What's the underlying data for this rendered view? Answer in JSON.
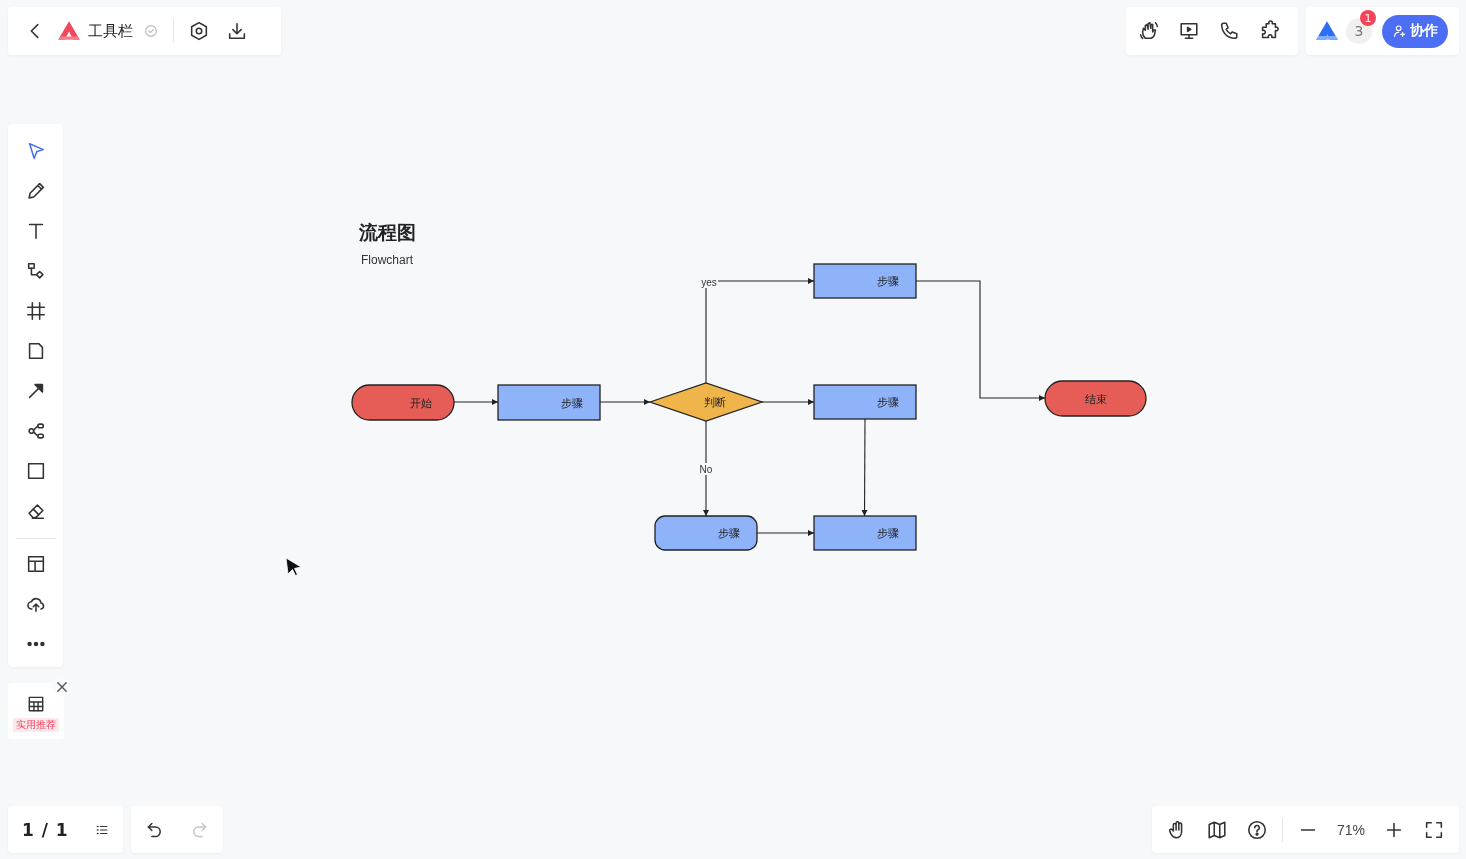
{
  "header": {
    "title": "工具栏",
    "saved": true,
    "actions": [
      {
        "kind": "settings"
      },
      {
        "kind": "download"
      }
    ]
  },
  "top_tools": [
    {
      "kind": "wave"
    },
    {
      "kind": "present"
    },
    {
      "kind": "call"
    },
    {
      "kind": "plugin"
    }
  ],
  "collaboration": {
    "member_count": "3",
    "notification_count": "1",
    "button": "协作"
  },
  "toolbar": {
    "tools": [
      {
        "kind": "select",
        "selected": true
      },
      {
        "kind": "pen",
        "selected": false
      },
      {
        "kind": "text",
        "selected": false
      },
      {
        "kind": "flow",
        "selected": false
      },
      {
        "kind": "frame",
        "selected": false
      },
      {
        "kind": "note",
        "selected": false
      },
      {
        "kind": "arrow",
        "selected": false
      },
      {
        "kind": "mindmap",
        "selected": false
      },
      {
        "kind": "shape",
        "selected": false
      },
      {
        "kind": "eraser",
        "selected": false
      }
    ],
    "extras": [
      {
        "kind": "template"
      },
      {
        "kind": "upload"
      },
      {
        "kind": "more"
      }
    ]
  },
  "recommend": {
    "label": "实用推荐"
  },
  "diagram": {
    "title": "流程图",
    "subtitle": "Flowchart",
    "nodes": [
      {
        "kind": "terminal",
        "label": "开始",
        "color": "#e65c57"
      },
      {
        "kind": "process",
        "label": "步骤",
        "color": "#8eb3f9"
      },
      {
        "kind": "decision",
        "label": "判断",
        "color": "#efb44a"
      },
      {
        "kind": "process",
        "label": "步骤",
        "color": "#8eb3f9"
      },
      {
        "kind": "process",
        "label": "步骤",
        "color": "#8eb3f9"
      },
      {
        "kind": "terminal",
        "label": "结束",
        "color": "#e65c57"
      },
      {
        "kind": "rounded",
        "label": "步骤",
        "color": "#8eb3f9"
      },
      {
        "kind": "process",
        "label": "步骤",
        "color": "#8eb3f9"
      }
    ],
    "connector_labels": [
      "yes",
      "No"
    ]
  },
  "pages": {
    "indicator": "1 / 1"
  },
  "history": [
    {
      "kind": "undo",
      "disabled": false
    },
    {
      "kind": "redo",
      "disabled": true
    }
  ],
  "view_tools": [
    {
      "kind": "hand"
    },
    {
      "kind": "map"
    },
    {
      "kind": "help"
    }
  ],
  "zoom": {
    "level_text": "71%"
  }
}
